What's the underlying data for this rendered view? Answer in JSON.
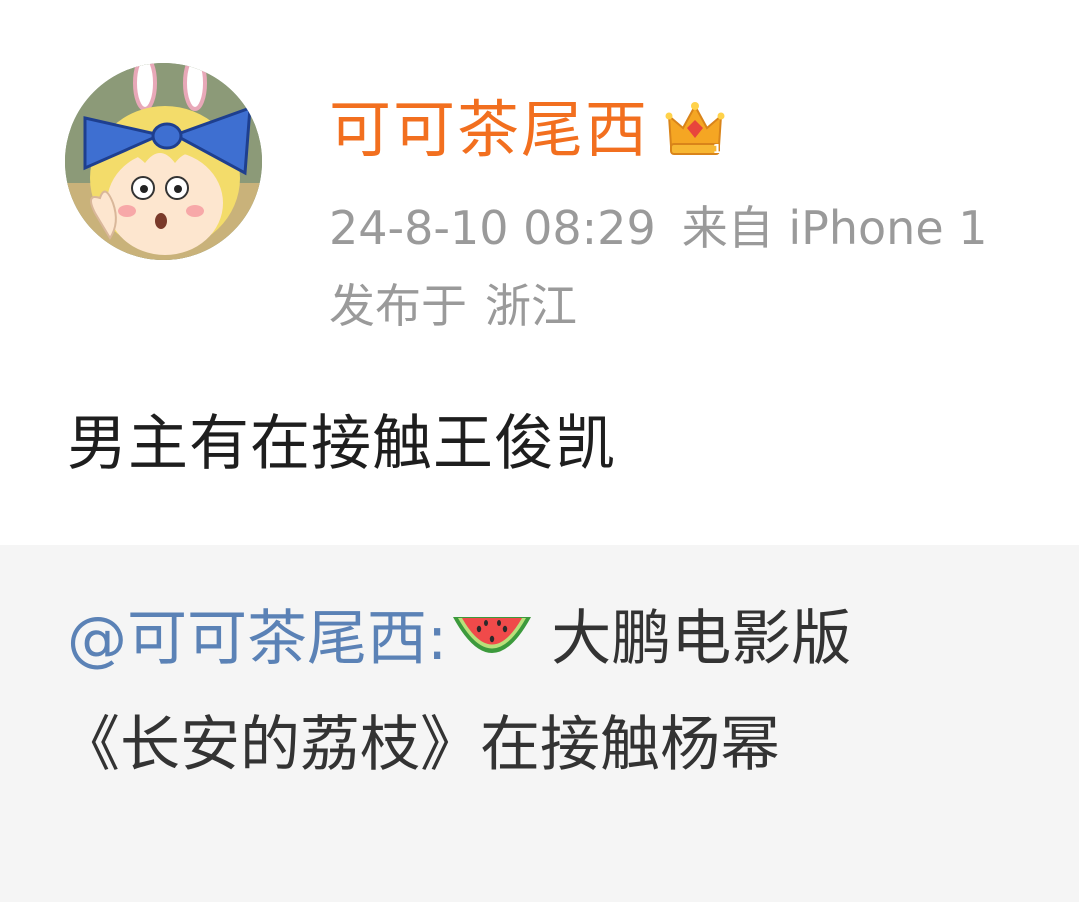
{
  "post": {
    "username": "可可茶尾西",
    "badge_icon": "crown-icon",
    "timestamp": "24-8-10 08:29",
    "source": "来自 iPhone 1",
    "location_label": "发布于",
    "location": "浙江",
    "text": "男主有在接触王俊凯"
  },
  "repost": {
    "user_mention": "@可可茶尾西:",
    "emoji_icon": "watermelon-icon",
    "text_part1": "大鹏电影版",
    "text_part2": "《长安的荔枝》在接触杨幂"
  },
  "colors": {
    "username": "#f26f1f",
    "meta": "#9a9a9a",
    "mention": "#5b82b6",
    "repost_bg": "#f5f5f5"
  }
}
